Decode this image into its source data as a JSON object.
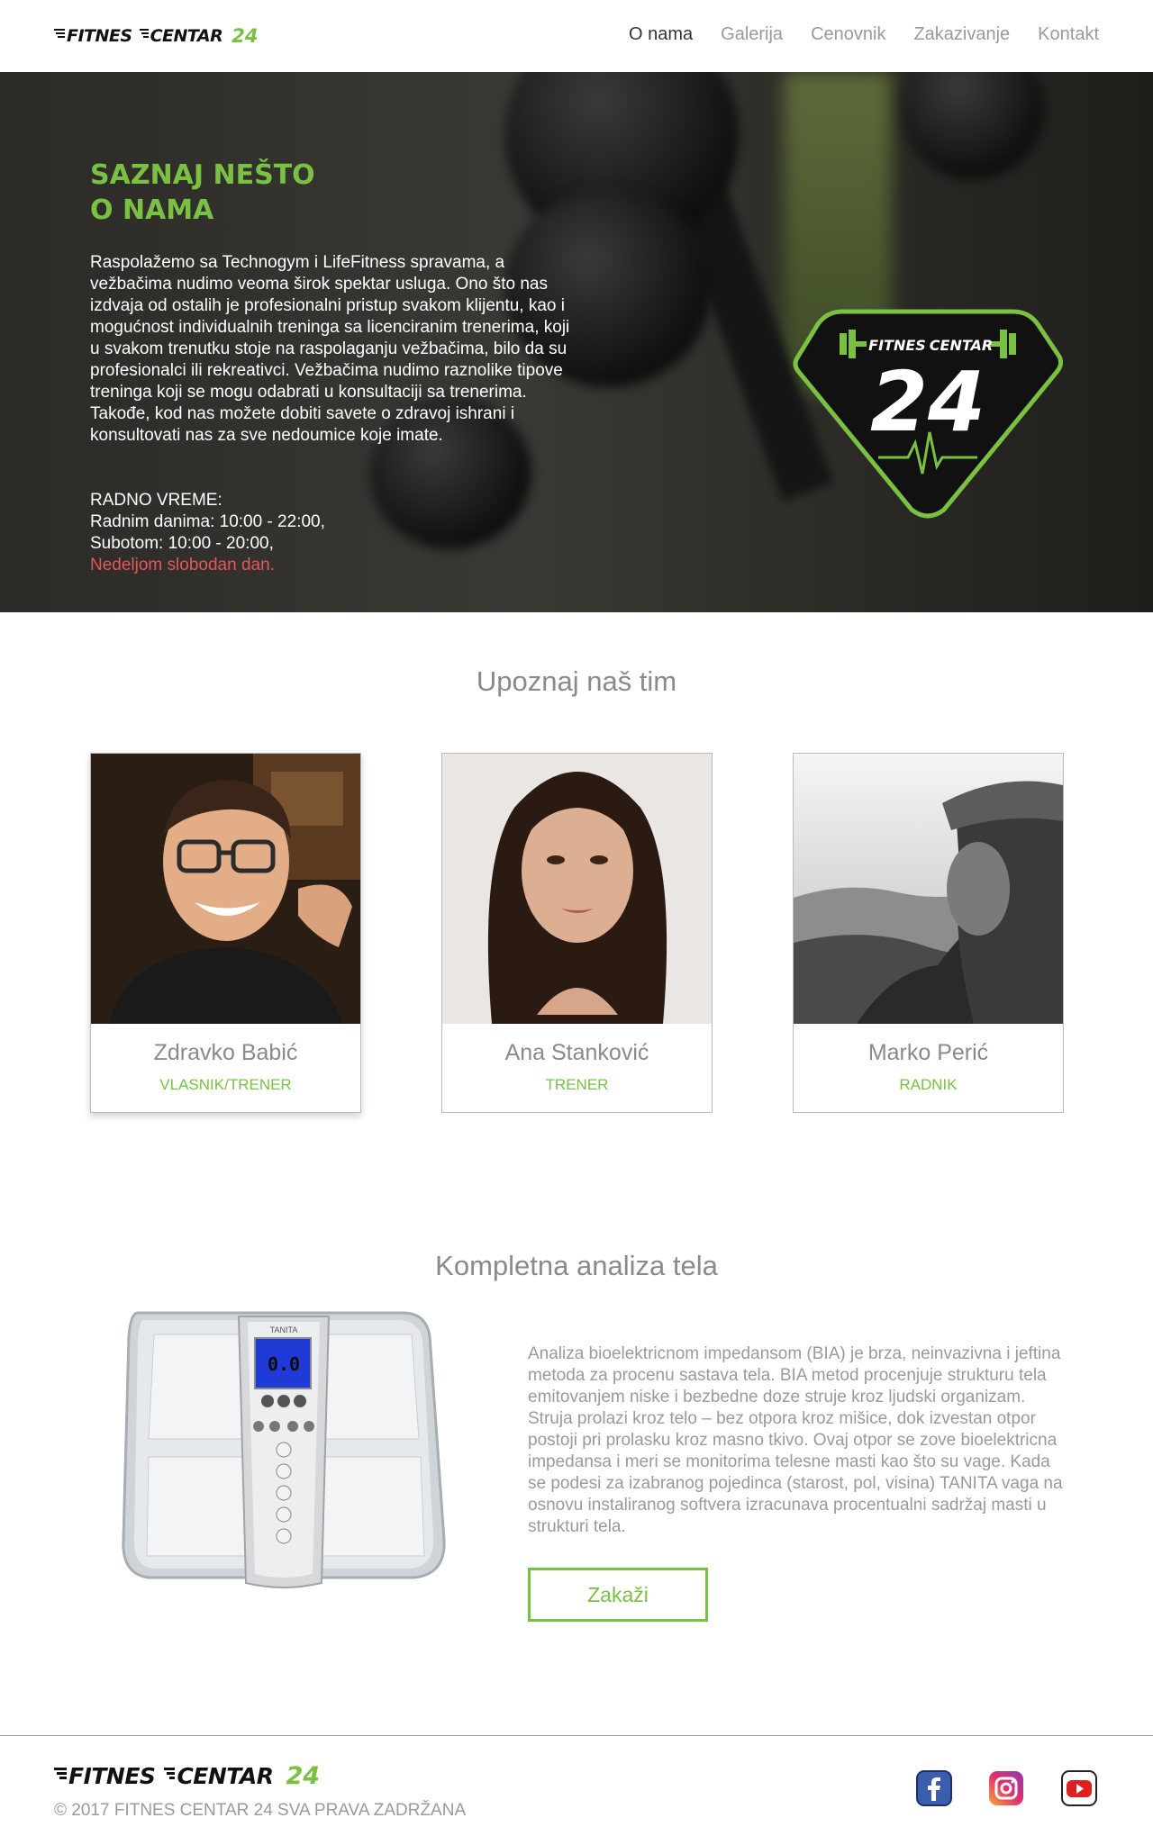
{
  "header": {
    "logo": {
      "word1": "FITNES",
      "word2": "CENTAR",
      "number": "24"
    },
    "nav": [
      "O nama",
      "Galerija",
      "Cenovnik",
      "Zakazivanje",
      "Kontakt"
    ]
  },
  "hero": {
    "title_line1": "SAZNAJ NEŠTO",
    "title_line2": "O NAMA",
    "paragraph1": "Raspolažemo sa Technogym i LifeFitness spravama, a vežbačima nudimo veoma širok spektar usluga. Ono što nas izdvaja od ostalih je profesionalni pristup svakom klijentu, kao i mogućnost individualnih treninga sa licenciranim trenerima, koji u svakom trenutku stoje na raspolaganju vežbačima, bilo da su profesionalci ili rekreativci. Vežbačima nudimo raznolike tipove treninga koji se mogu odabrati u konsultaciji sa trenerima.",
    "paragraph2": "Takođe, kod nas možete dobiti savete o zdravoj ishrani i konsultovati nas za sve nedoumice koje imate.",
    "hours_title": "RADNO VREME:",
    "weekdays": "Radnim danima: 10:00 - 22:00,",
    "saturday": "Subotom: 10:00 - 20:00,",
    "sunday": "Nedeljom slobodan dan.",
    "badge": {
      "word1": "FITNES",
      "word2": "CENTAR",
      "number": "24"
    }
  },
  "team": {
    "title": "Upoznaj naš tim",
    "members": [
      {
        "name": "Zdravko Babić",
        "role": "VLASNIK/TRENER"
      },
      {
        "name": "Ana Stanković",
        "role": "TRENER"
      },
      {
        "name": "Marko Perić",
        "role": "RADNIK"
      }
    ]
  },
  "analysis": {
    "title": "Kompletna analiza tela",
    "text": "Analiza bioelektricnom impedansom (BIA) je brza, neinvazivna i jeftina metoda za procenu sastava tela. BIA metod procenjuje strukturu tela emitovanjem niske i bezbedne doze struje kroz ljudski organizam. Struja prolazi kroz telo – bez otpora kroz mišice, dok izvestan otpor postoji pri prolasku kroz masno tkivo. Ovaj otpor se zove bioelektricna impedansa i meri se monitorima telesne masti kao što su vage. Kada se podesi za izabranog pojedinca (starost, pol, visina) TANITA vaga na osnovu instaliranog softvera izracunava procentualni sadržaj masti u strukturi tela.",
    "button": "Zakaži",
    "scale_brand": "TANITA",
    "scale_display": "0.0"
  },
  "footer": {
    "logo": {
      "word1": "FITNES",
      "word2": "CENTAR",
      "number": "24"
    },
    "copyright": "© 2017  FITNES CENTAR 24 SVA PRAVA ZADRŽANA",
    "social": [
      "facebook-icon",
      "instagram-icon",
      "youtube-icon"
    ]
  },
  "colors": {
    "accent": "#7ac143",
    "closed": "#e4575a",
    "muted": "#9a9a9a"
  }
}
